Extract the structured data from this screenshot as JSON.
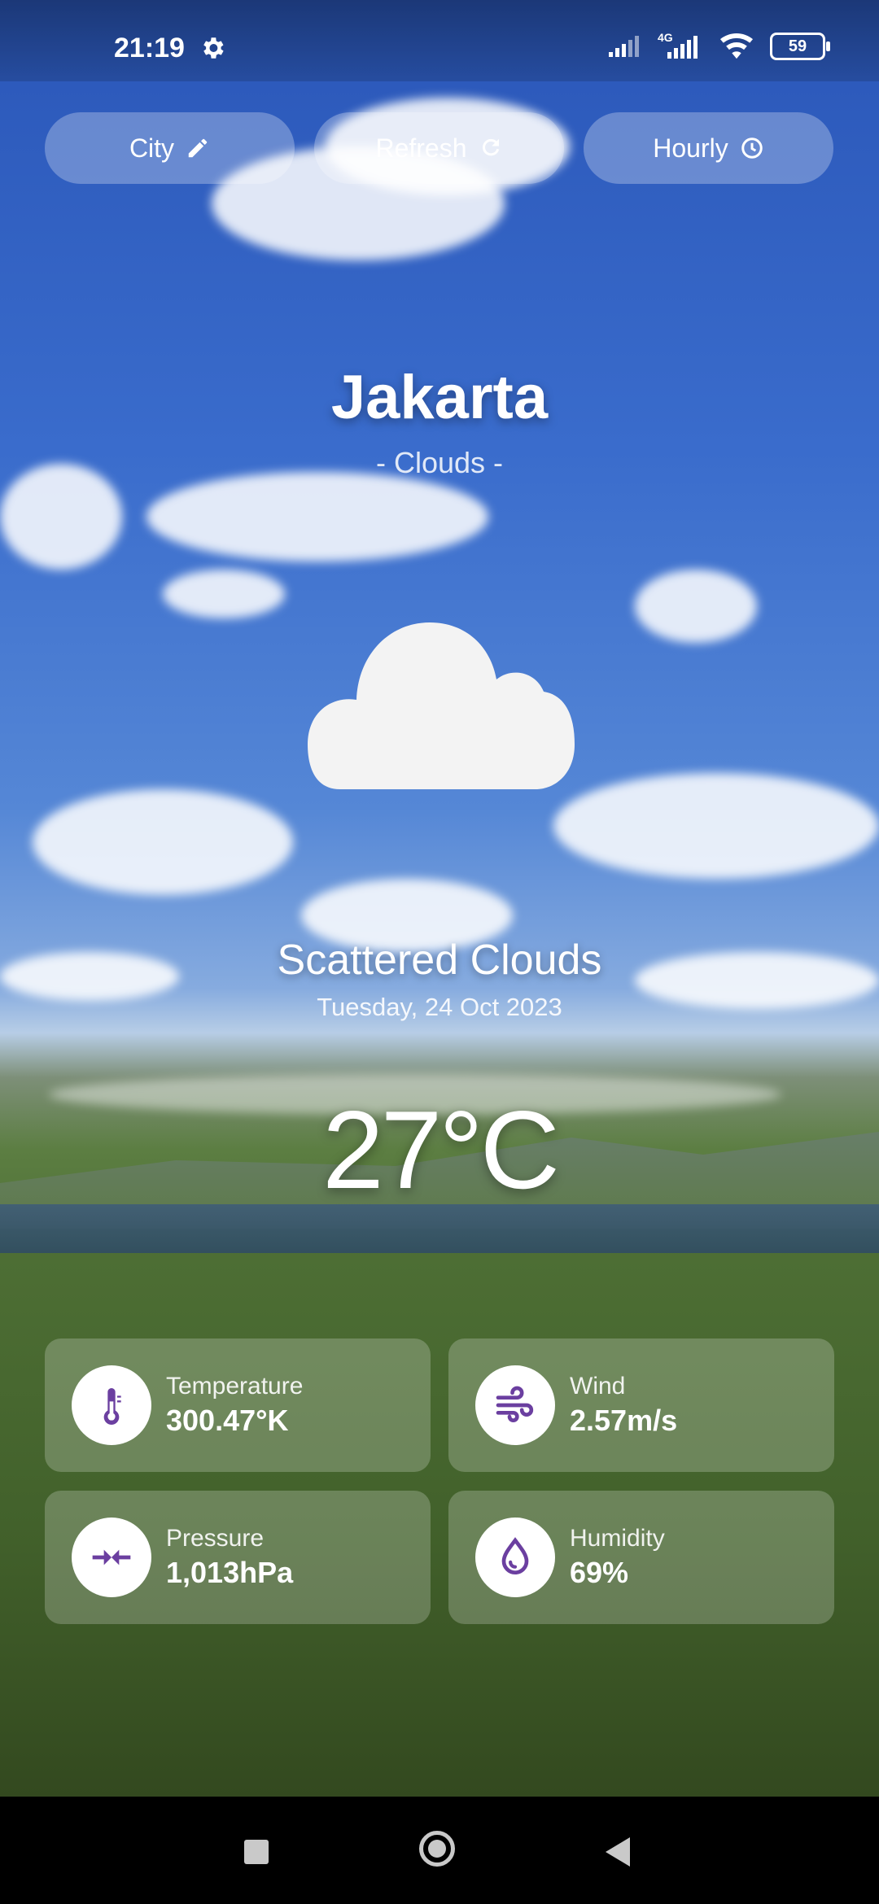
{
  "status_bar": {
    "time": "21:19",
    "network": "4G",
    "battery": "59"
  },
  "top_buttons": [
    {
      "label": "City",
      "icon": "pencil-icon"
    },
    {
      "label": "Refresh",
      "icon": "refresh-icon"
    },
    {
      "label": "Hourly",
      "icon": "clock-icon"
    }
  ],
  "weather": {
    "city": "Jakarta",
    "condition": "- Clouds -",
    "description": "Scattered Clouds",
    "date": "Tuesday, 24 Oct 2023",
    "temperature": "27°C"
  },
  "cards": [
    {
      "label": "Temperature",
      "value": "300.47°K",
      "icon": "thermometer-icon"
    },
    {
      "label": "Wind",
      "value": "2.57m/s",
      "icon": "wind-icon"
    },
    {
      "label": "Pressure",
      "value": "1,013hPa",
      "icon": "pressure-icon"
    },
    {
      "label": "Humidity",
      "value": "69%",
      "icon": "droplet-icon"
    }
  ],
  "colors": {
    "accent": "#6b3fa0"
  }
}
